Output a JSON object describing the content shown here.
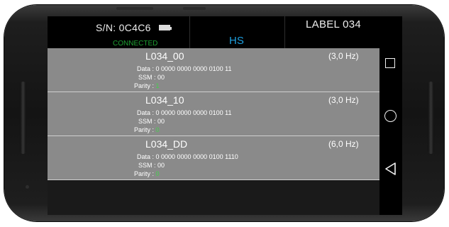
{
  "header": {
    "serial": "S/N: 0C4C6",
    "connection_status": "CONNECTED",
    "mode": "HS",
    "label": "LABEL 034",
    "battery_icon": "battery-icon"
  },
  "rows": [
    {
      "title": "L034_00",
      "rate": "(3,0 Hz)",
      "data_label": "Data : ",
      "data": "0 0000 0000 0000 0100 11",
      "ssm_label": "SSM : ",
      "ssm": "00",
      "parity_label": "Parity : ",
      "parity": "1"
    },
    {
      "title": "L034_10",
      "rate": "(3,0 Hz)",
      "data_label": "Data : ",
      "data": "0 0000 0000 0000 0100 11",
      "ssm_label": "SSM : ",
      "ssm": "00",
      "parity_label": "Parity : ",
      "parity": "0"
    },
    {
      "title": "L034_DD",
      "rate": "(6,0 Hz)",
      "data_label": "Data : ",
      "data": "0 0000 0000 0000 0100 1110",
      "ssm_label": "SSM : ",
      "ssm": "00",
      "parity_label": "Parity : ",
      "parity": "0"
    }
  ],
  "navigation": {
    "recents_icon": "square-icon",
    "home_icon": "circle-icon",
    "back_icon": "triangle-back-icon"
  },
  "colors": {
    "connected": "#1ea032",
    "mode": "#1ea0e0",
    "parity": "#43d14b",
    "row_background": "#8a8a8a"
  }
}
